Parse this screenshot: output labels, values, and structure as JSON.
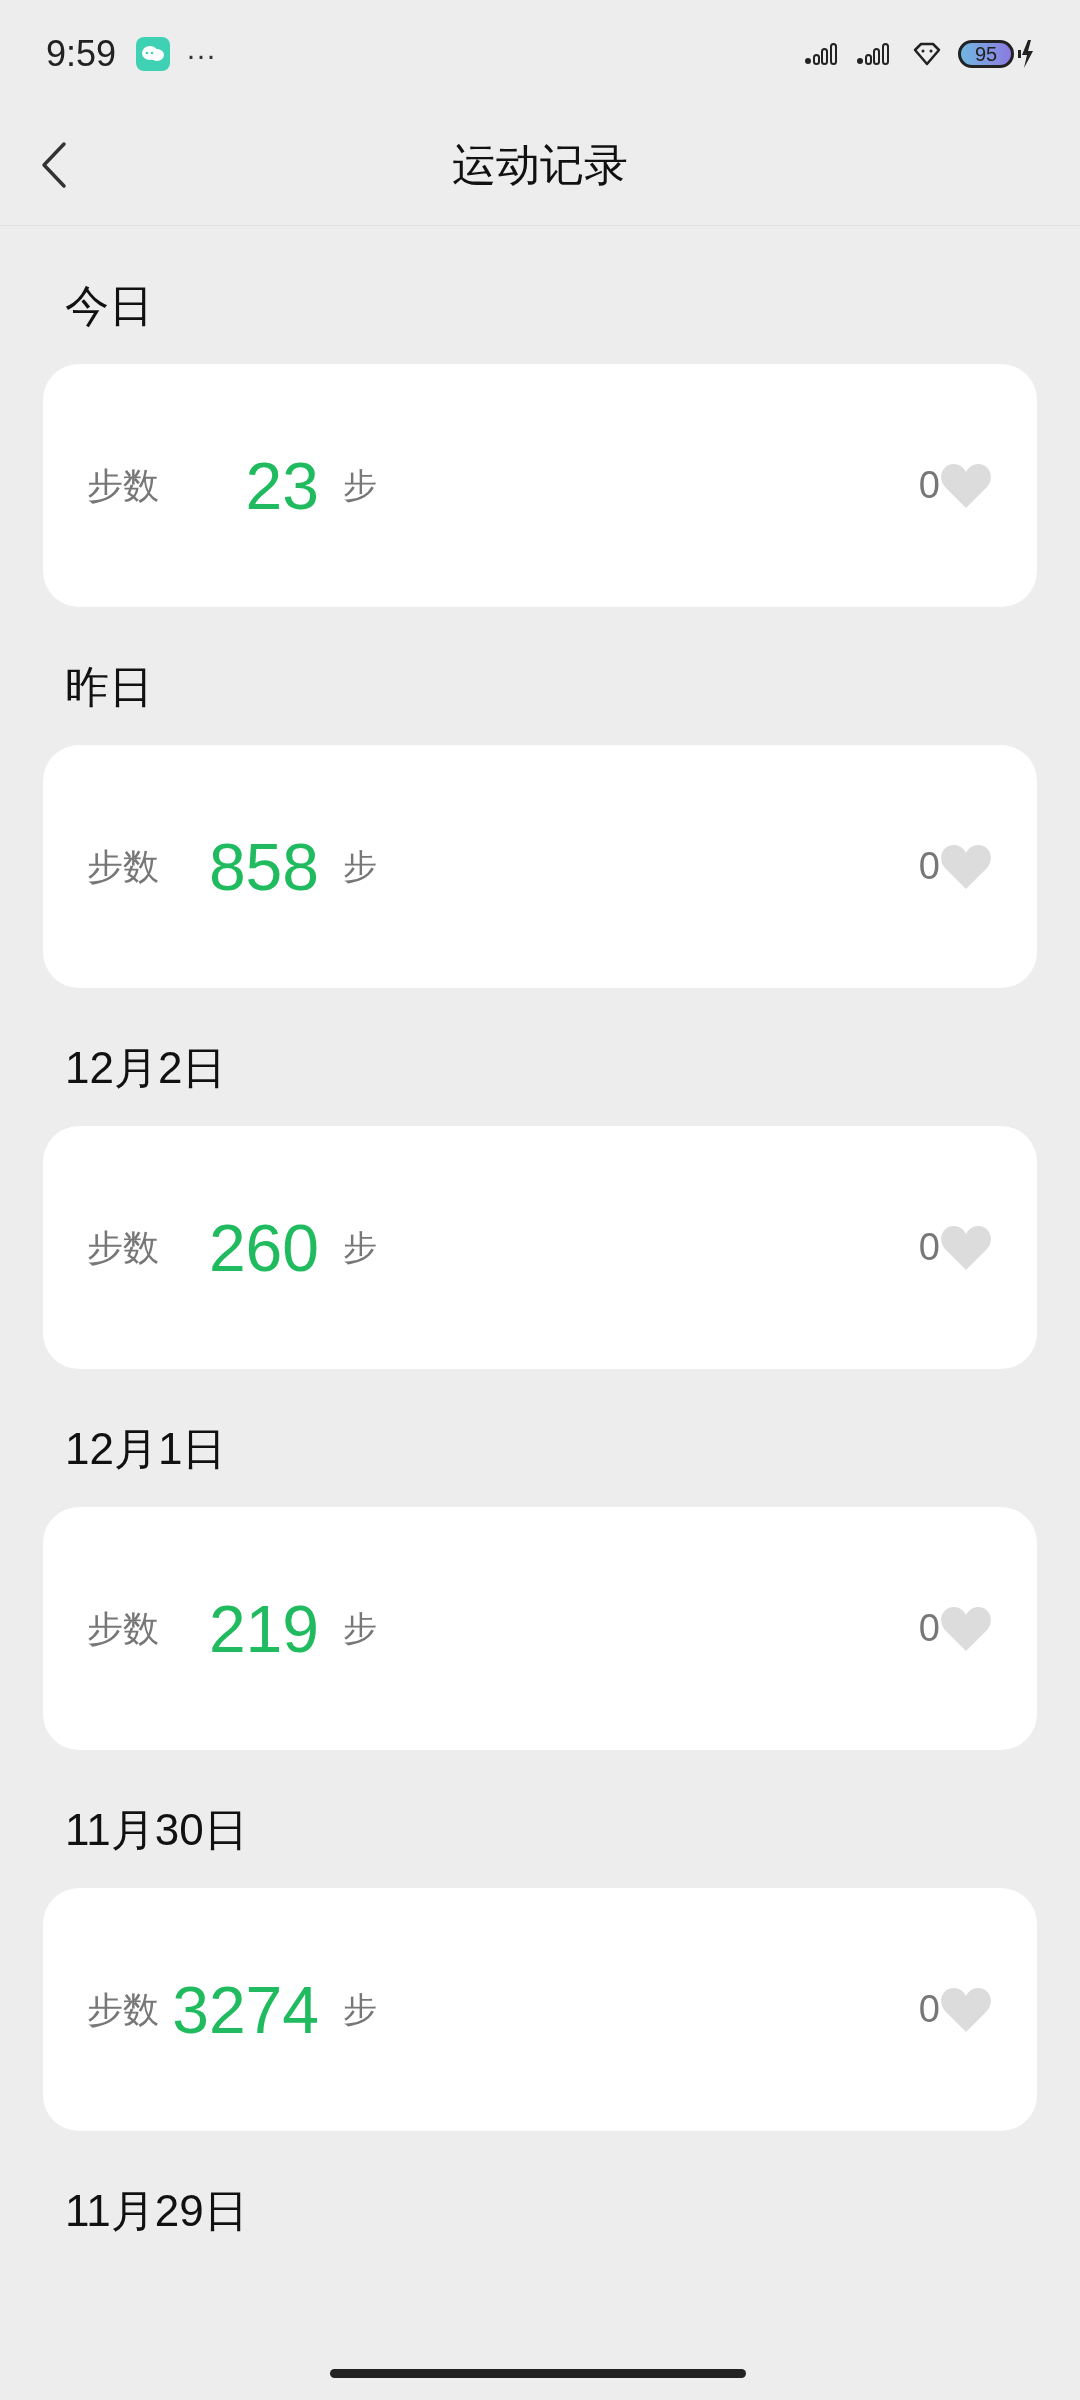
{
  "status_bar": {
    "time": "9:59",
    "more": "···",
    "battery": "95"
  },
  "nav": {
    "title": "运动记录"
  },
  "records": [
    {
      "date": "今日",
      "label": "步数",
      "steps": "23",
      "unit": "步",
      "likes": "0",
      "liked": false
    },
    {
      "date": "昨日",
      "label": "步数",
      "steps": "858",
      "unit": "步",
      "likes": "0",
      "liked": false
    },
    {
      "date": "12月2日",
      "label": "步数",
      "steps": "260",
      "unit": "步",
      "likes": "0",
      "liked": false
    },
    {
      "date": "12月1日",
      "label": "步数",
      "steps": "219",
      "unit": "步",
      "likes": "0",
      "liked": false
    },
    {
      "date": "11月30日",
      "label": "步数",
      "steps": "3274",
      "unit": "步",
      "likes": "0",
      "liked": false
    }
  ],
  "trailing_date": "11月29日"
}
